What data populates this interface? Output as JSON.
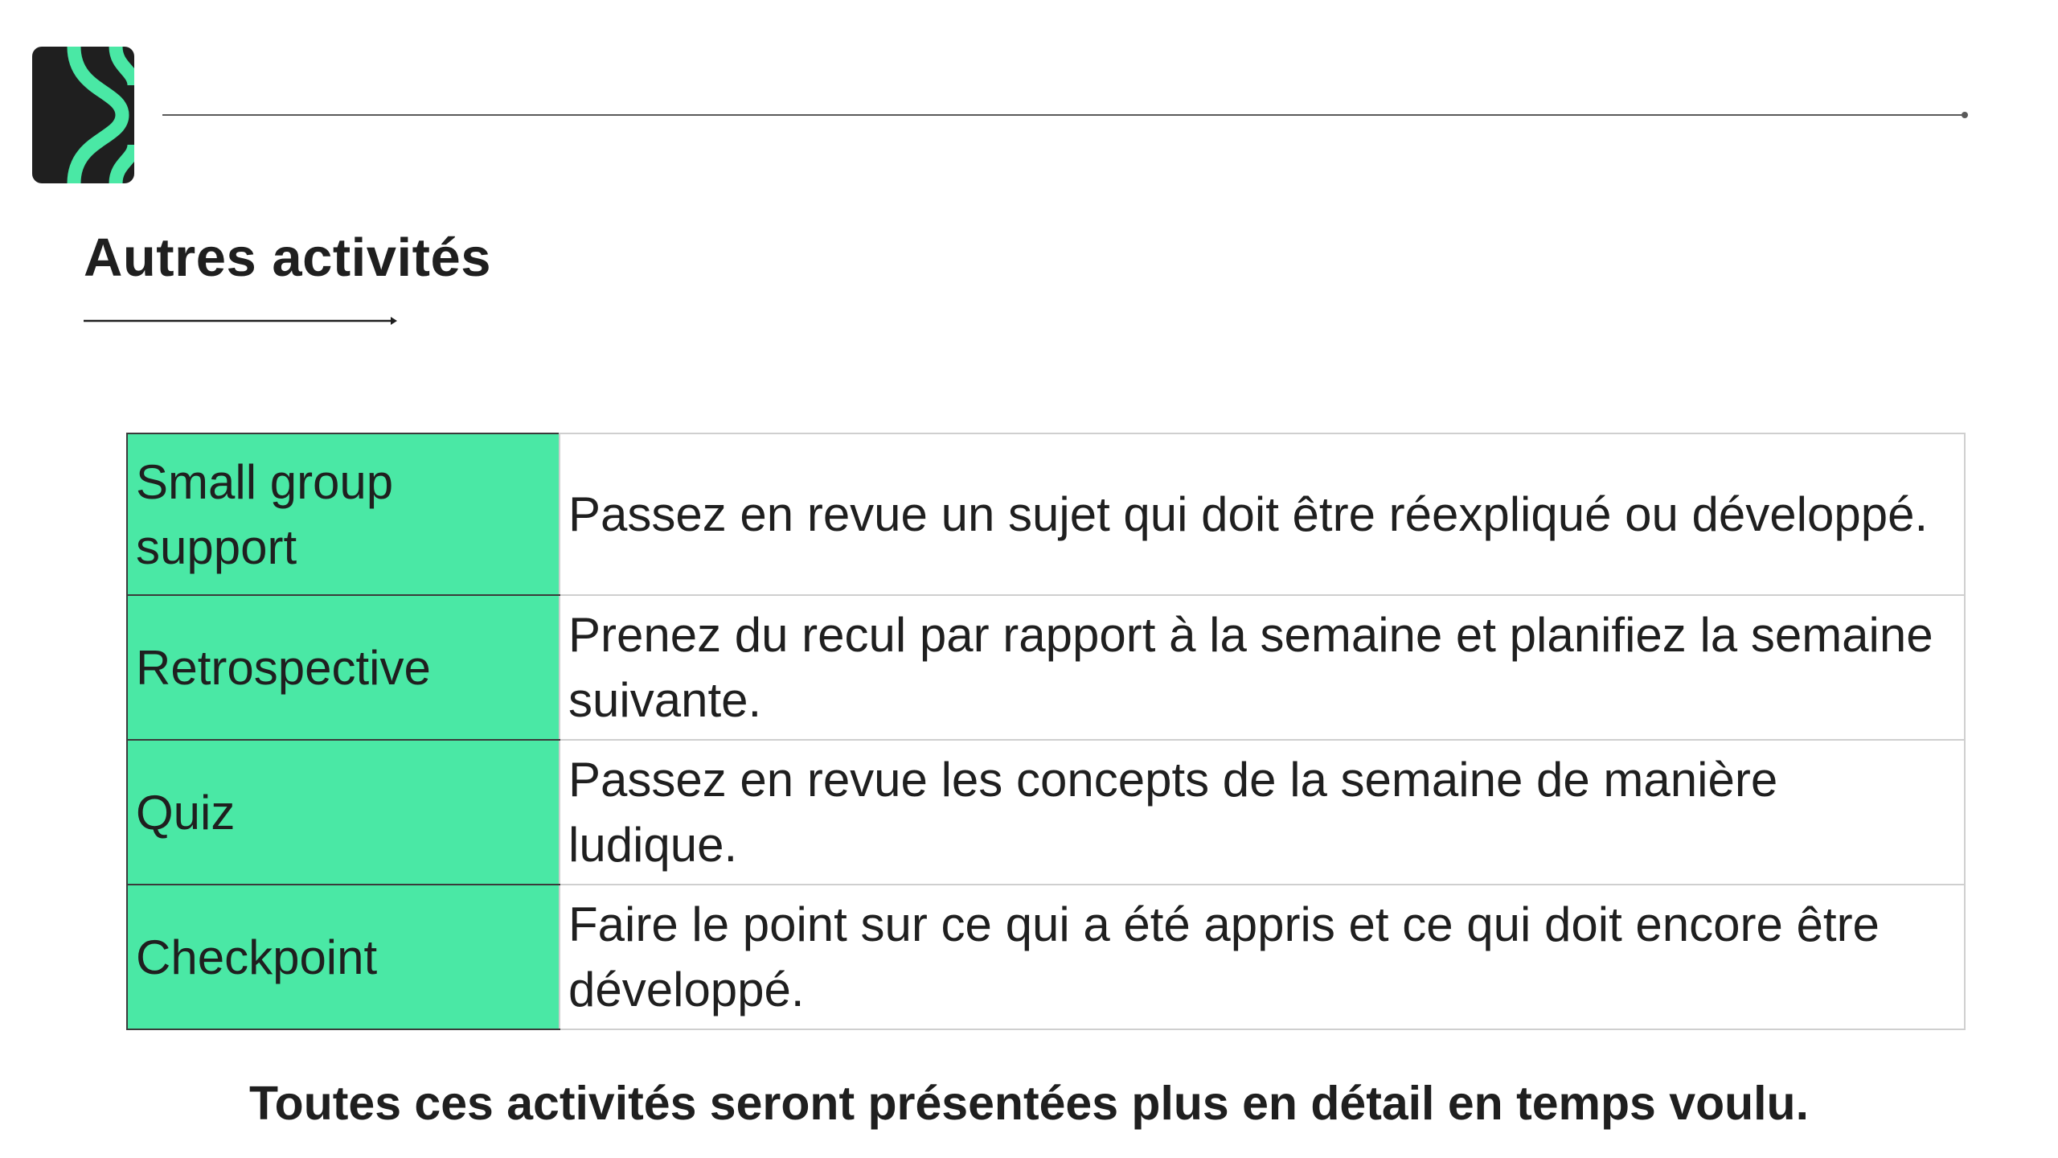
{
  "header": {
    "logo_icon": "brand-logo-icon"
  },
  "title": "Autres activités",
  "table": {
    "rows": [
      {
        "name": "Small group support",
        "description": "Passez en revue un sujet qui doit être réexpliqué ou développé."
      },
      {
        "name": "Retrospective",
        "description": "Prenez du recul par rapport à la semaine et planifiez la semaine suivante."
      },
      {
        "name": "Quiz",
        "description": "Passez en revue les concepts de la semaine de manière ludique."
      },
      {
        "name": "Checkpoint",
        "description": "Faire le point sur ce qui a été appris et ce qui doit encore être développé."
      }
    ]
  },
  "footer_note": "Toutes ces activités seront présentées plus en détail en temps voulu.",
  "colors": {
    "accent": "#4ae8a5",
    "logo_background": "#1f1f1f",
    "text": "#1f1f1f"
  }
}
